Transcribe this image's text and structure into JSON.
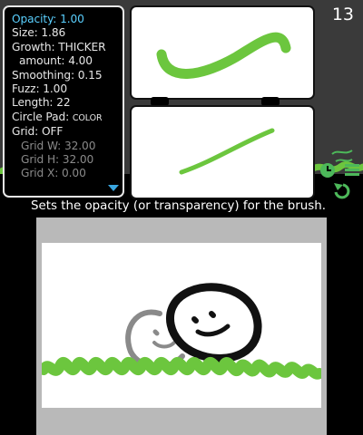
{
  "settings": {
    "options": [
      {
        "label": "Opacity: 1.00",
        "selected": true
      },
      {
        "label": "Size: 1.86"
      },
      {
        "label": "Growth: THICKER"
      },
      {
        "label": "amount: 4.00"
      },
      {
        "label": "Smoothing: 0.15"
      },
      {
        "label": "Fuzz: 1.00"
      },
      {
        "label": "Length: 22"
      },
      {
        "label_main": "Circle Pad: ",
        "label_small": "COLOR"
      },
      {
        "label": "Grid: OFF"
      },
      {
        "label": "Grid W: 32.00"
      },
      {
        "label": "Grid H: 32.00"
      },
      {
        "label": "Grid X: 0.00"
      }
    ]
  },
  "page_number": "13",
  "help_text": "Sets the opacity (or transparency) for the brush.",
  "colors": {
    "brush_green": "#6cc63e",
    "selected_text": "#5ad0ff",
    "panel_bg": "#000000",
    "icon_green": "#4db85a"
  },
  "icons": {
    "side": [
      "wave-icon",
      "clock-icon",
      "list-icon",
      "undo-icon"
    ]
  }
}
